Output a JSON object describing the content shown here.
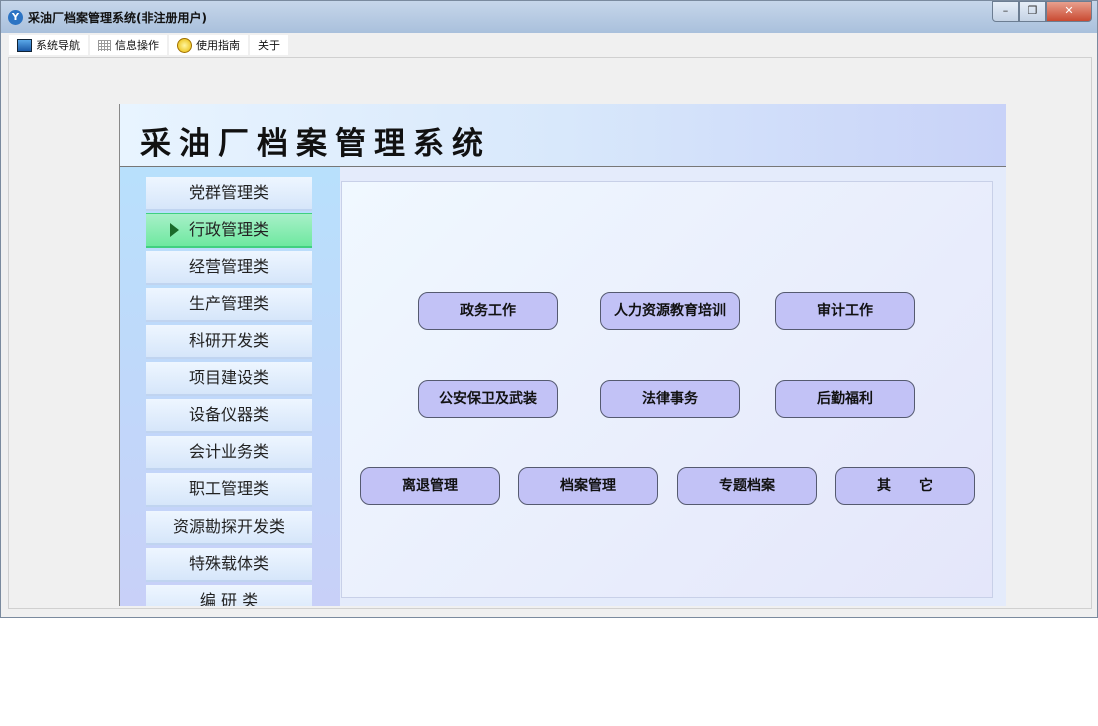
{
  "window": {
    "title": "采油厂档案管理系统(非注册用户)",
    "minimize": "–",
    "maximize": "❐",
    "close": "✕"
  },
  "menu": [
    {
      "label": "系统导航",
      "icon": "window-icon"
    },
    {
      "label": "信息操作",
      "icon": "grid-icon"
    },
    {
      "label": "使用指南",
      "icon": "help-icon"
    },
    {
      "label": "关于"
    }
  ],
  "header": {
    "title": "采油厂档案管理系统"
  },
  "sidebar": {
    "items": [
      "党群管理类",
      "行政管理类",
      "经营管理类",
      "生产管理类",
      "科研开发类",
      "项目建设类",
      "设备仪器类",
      "会计业务类",
      "职工管理类",
      "资源勘探开发类",
      "特殊载体类",
      "编 研 类"
    ],
    "active": "行政管理类"
  },
  "buttons": [
    "政务工作",
    "人力资源教育培训",
    "审计工作",
    "公安保卫及武装",
    "法律事务",
    "后勤福利",
    "离退管理",
    "档案管理",
    "专题档案",
    "其　　它"
  ]
}
